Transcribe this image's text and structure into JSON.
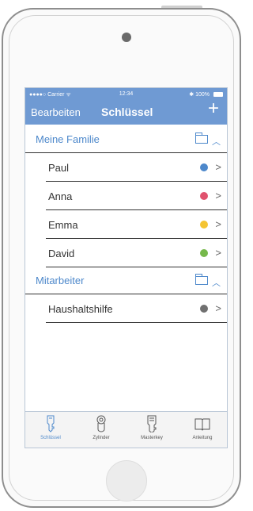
{
  "status": {
    "carrier": "●●●●○ Carrier ᯤ",
    "time": "12:34",
    "right": "✱ 100%"
  },
  "nav": {
    "edit": "Bearbeiten",
    "title": "Schlüssel",
    "add": "+"
  },
  "sections": [
    {
      "label": "Meine Familie",
      "items": [
        {
          "name": "Paul",
          "color": "#4d88cb"
        },
        {
          "name": "Anna",
          "color": "#e0526e"
        },
        {
          "name": "Emma",
          "color": "#f4c432"
        },
        {
          "name": "David",
          "color": "#76b84b"
        }
      ]
    },
    {
      "label": "Mitarbeiter",
      "items": [
        {
          "name": "Haushaltshilfe",
          "color": "#707070"
        }
      ]
    }
  ],
  "tabs": [
    {
      "label": "Schlüssel",
      "icon": "key-icon",
      "active": true
    },
    {
      "label": "Zylinder",
      "icon": "cylinder-icon",
      "active": false
    },
    {
      "label": "Masterkey",
      "icon": "masterkey-icon",
      "active": false
    },
    {
      "label": "Anleitung",
      "icon": "book-icon",
      "active": false
    }
  ],
  "colors": {
    "accent": "#4d88cb",
    "nav_bar": "#6f9ad3"
  }
}
